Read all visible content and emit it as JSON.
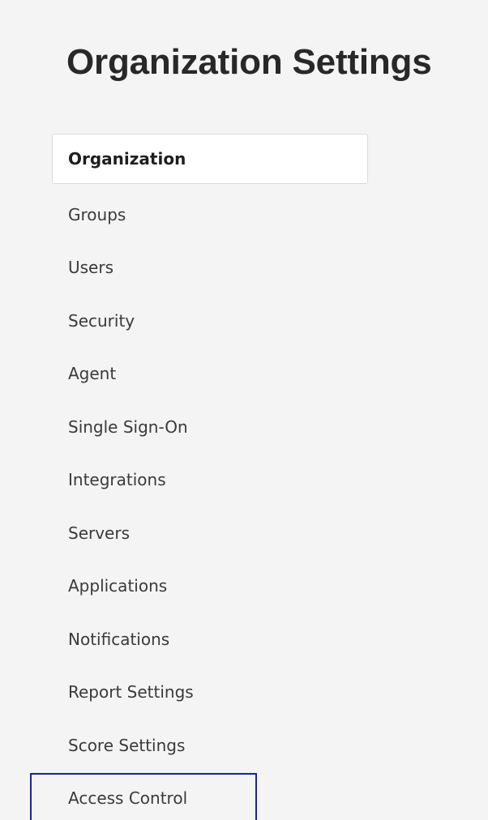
{
  "page_title": "Organization Settings",
  "nav": {
    "items": [
      {
        "label": "Organization",
        "state": "selected"
      },
      {
        "label": "Groups"
      },
      {
        "label": "Users"
      },
      {
        "label": "Security"
      },
      {
        "label": "Agent"
      },
      {
        "label": "Single Sign-On"
      },
      {
        "label": "Integrations"
      },
      {
        "label": "Servers"
      },
      {
        "label": "Applications"
      },
      {
        "label": "Notifications"
      },
      {
        "label": "Report Settings"
      },
      {
        "label": "Score Settings"
      },
      {
        "label": "Access Control",
        "state": "focused"
      }
    ]
  },
  "colors": {
    "background": "#f4f4f4",
    "selected_item_background": "#ffffff",
    "focus_outline": "#1b1fa8",
    "title_text": "#282828",
    "item_text": "#3a3a3a"
  }
}
